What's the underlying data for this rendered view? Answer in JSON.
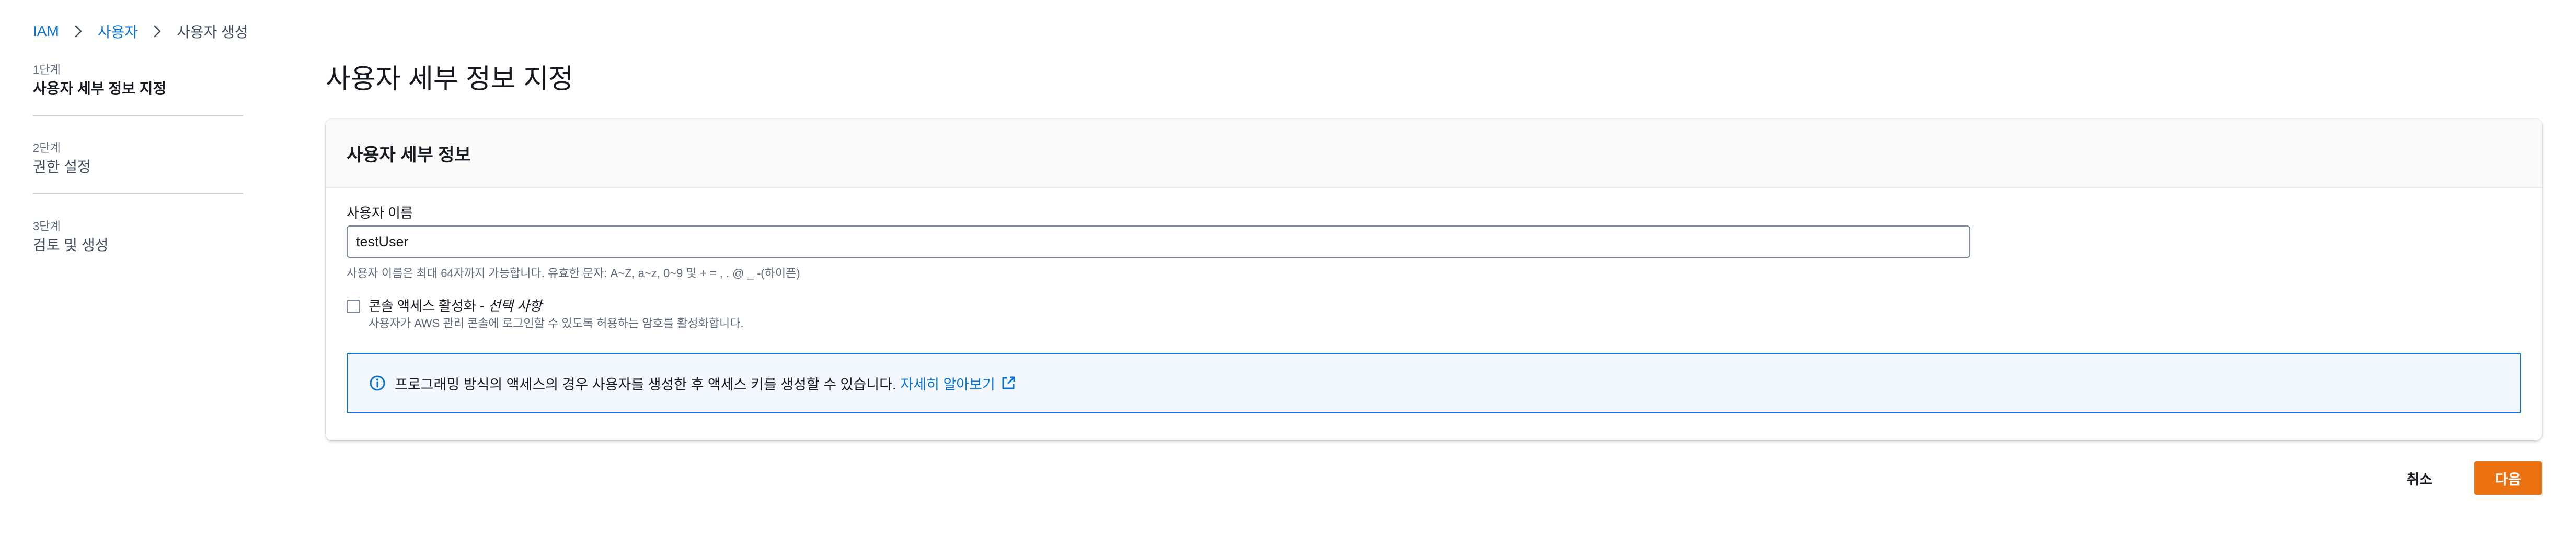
{
  "breadcrumb": {
    "items": [
      "IAM",
      "사용자"
    ],
    "current": "사용자 생성"
  },
  "steps": [
    {
      "number": "1단계",
      "title": "사용자 세부 정보 지정",
      "active": true
    },
    {
      "number": "2단계",
      "title": "권한 설정",
      "active": false
    },
    {
      "number": "3단계",
      "title": "검토 및 생성",
      "active": false
    }
  ],
  "page": {
    "title": "사용자 세부 정보 지정"
  },
  "user_details": {
    "header": "사용자 세부 정보",
    "username_label": "사용자 이름",
    "username_value": "testUser",
    "username_hint": "사용자 이름은 최대 64자까지 가능합니다. 유효한 문자: A~Z, a~z, 0~9 및 + = , . @ _ -(하이픈)",
    "console_access_label": "콘솔 액세스 활성화 - ",
    "console_access_optional": "선택 사항",
    "console_access_checked": false,
    "console_access_desc": "사용자가 AWS 관리 콘솔에 로그인할 수 있도록 허용하는 암호를 활성화합니다.",
    "info_text": "프로그래밍 방식의 액세스의 경우 사용자를 생성한 후 액세스 키를 생성할 수 있습니다.",
    "info_link": "자세히 알아보기"
  },
  "actions": {
    "cancel": "취소",
    "next": "다음"
  },
  "colors": {
    "link": "#0972d3",
    "primary": "#ec7211",
    "info_bg": "#f2f8fd"
  },
  "icons": {
    "breadcrumb_separator": "chevron-right-icon",
    "info": "info-icon",
    "external_link": "external-link-icon"
  }
}
